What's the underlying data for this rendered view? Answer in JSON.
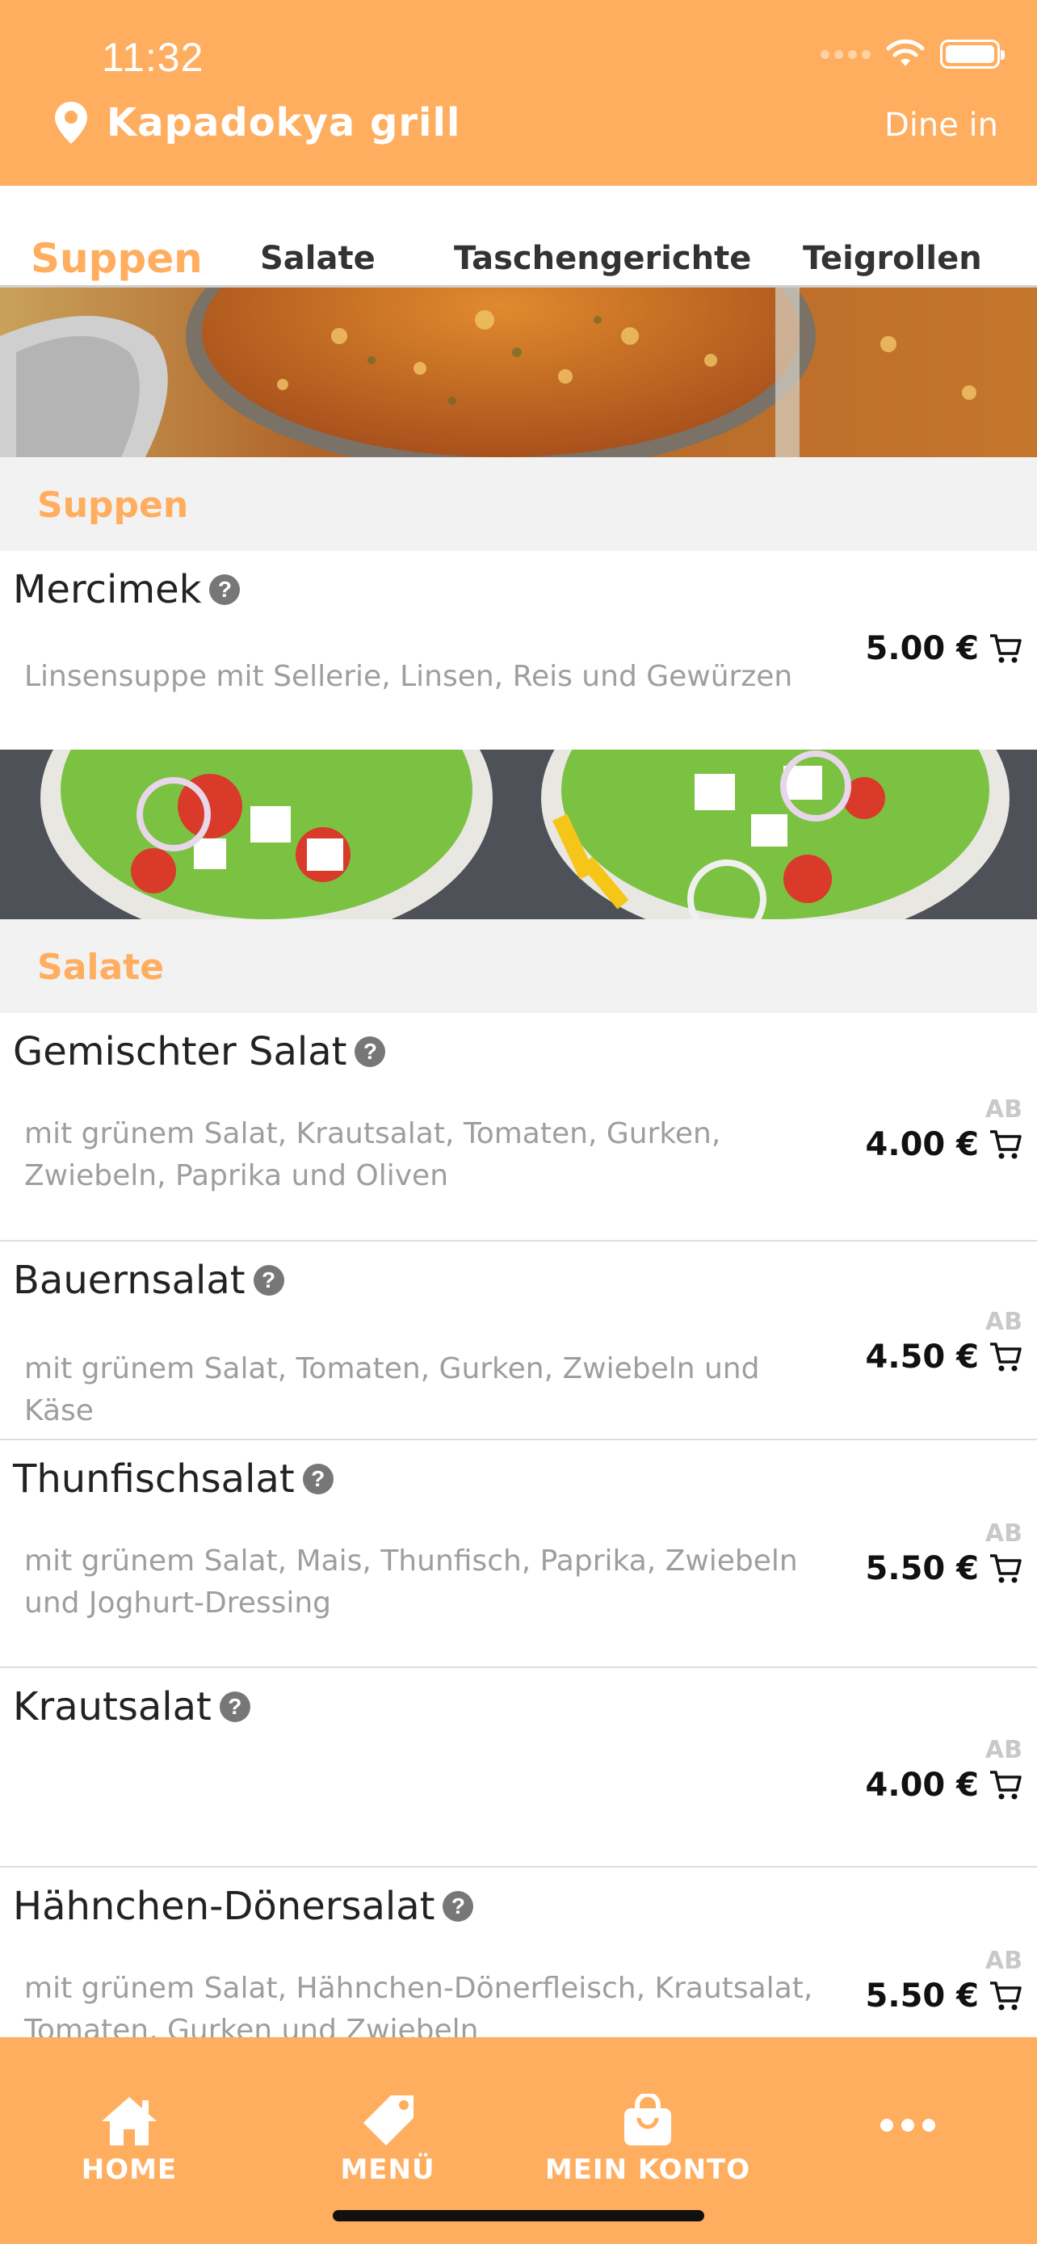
{
  "status_bar": {
    "time": "11:32"
  },
  "header": {
    "store_name": "Kapadokya grill",
    "mode": "Dine in"
  },
  "tabs": [
    {
      "label": "Suppen",
      "active": true
    },
    {
      "label": "Salate",
      "active": false
    },
    {
      "label": "Taschengerichte",
      "active": false
    },
    {
      "label": "Teigrollen",
      "active": false
    }
  ],
  "sections": [
    {
      "title": "Suppen",
      "items": [
        {
          "name": "Mercimek",
          "description": "Linsensuppe mit Sellerie, Linsen, Reis und Gewürzen",
          "price": "5.00 €",
          "ab": ""
        }
      ]
    },
    {
      "title": "Salate",
      "items": [
        {
          "name": "Gemischter Salat",
          "description": "mit grünem Salat, Krautsalat, Tomaten, Gurken, Zwiebeln, Paprika und Oliven",
          "price": "4.00 €",
          "ab": "AB"
        },
        {
          "name": "Bauernsalat",
          "description": "mit grünem Salat, Tomaten, Gurken, Zwiebeln und Käse",
          "price": "4.50 €",
          "ab": "AB"
        },
        {
          "name": "Thunfischsalat",
          "description": "mit grünem Salat, Mais, Thunfisch, Paprika, Zwiebeln und Joghurt-Dressing",
          "price": "5.50 €",
          "ab": "AB"
        },
        {
          "name": "Krautsalat",
          "description": "",
          "price": "4.00 €",
          "ab": "AB"
        },
        {
          "name": "Hähnchen-Dönersalat",
          "description": "mit grünem Salat, Hähnchen-Dönerfleisch, Krautsalat, Tomaten, Gurken und Zwiebeln",
          "price": "5.50 €",
          "ab": "AB"
        }
      ]
    }
  ],
  "bottom_nav": [
    {
      "label": "HOME",
      "icon": "home-icon"
    },
    {
      "label": "MENÜ",
      "icon": "tag-icon"
    },
    {
      "label": "MEIN KONTO",
      "icon": "shopping-bag-icon"
    },
    {
      "label": "",
      "icon": "more-icon"
    }
  ],
  "colors": {
    "accent": "#FFAD5E",
    "section_bg": "#F2F2F2",
    "text": "#222222",
    "muted": "#9E9E9E"
  }
}
